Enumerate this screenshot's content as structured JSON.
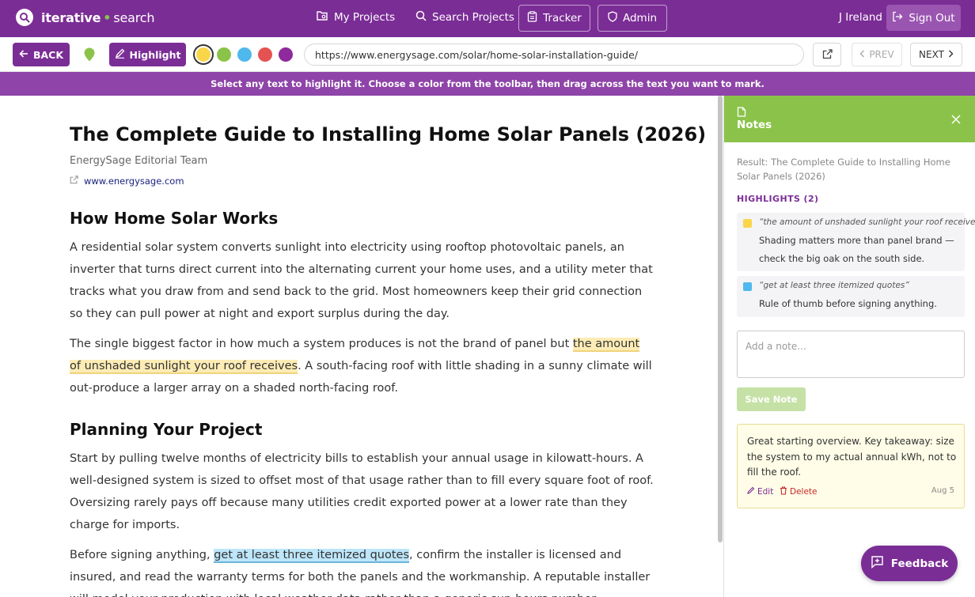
{
  "app": {
    "name_part1": "iterative",
    "name_part2": "search",
    "colors": {
      "primary": "#7b2d96",
      "accent": "#8bc34a",
      "banner": "#8e44a8"
    }
  },
  "nav": {
    "my_projects": "My Projects",
    "search_projects": "Search Projects",
    "tracker": "Tracker",
    "admin": "Admin",
    "user": "J Ireland",
    "sign_out": "Sign Out"
  },
  "toolbar": {
    "back": "BACK",
    "highlight": "Highlight",
    "colors": [
      {
        "name": "yellow",
        "hex": "#f9d54a",
        "selected": true
      },
      {
        "name": "green",
        "hex": "#8bc34a",
        "selected": false
      },
      {
        "name": "blue",
        "hex": "#4fb8ec",
        "selected": false
      },
      {
        "name": "red",
        "hex": "#e55252",
        "selected": false
      },
      {
        "name": "purple",
        "hex": "#8e2a9b",
        "selected": false
      }
    ],
    "url": "https://www.energysage.com/solar/home-solar-installation-guide/",
    "prev": "PREV",
    "next": "NEXT"
  },
  "banner": "Select any text to highlight it. Choose a color from the toolbar, then drag across the text you want to mark.",
  "article": {
    "title": "The Complete Guide to Installing Home Solar Panels (2026)",
    "author": "EnergySage Editorial Team",
    "site": "www.energysage.com",
    "section1": "How Home Solar Works",
    "p1": "A residential solar system converts sunlight into electricity using rooftop photovoltaic panels, an inverter that turns direct current into the alternating current your home uses, and a utility meter that tracks what you draw from and send back to the grid. Most homeowners keep their grid connection so they can pull power at night and export surplus during the day.",
    "p2_before": "The single biggest factor in how much a system produces is not the brand of panel but ",
    "p2_highlight": "the amount of unshaded sunlight your roof receives",
    "p2_after": ". A south-facing roof with little shading in a sunny climate will out-produce a larger array on a shaded north-facing roof.",
    "section2": "Planning Your Project",
    "p3": "Start by pulling twelve months of electricity bills to establish your annual usage in kilowatt-hours. A well-designed system is sized to offset most of that usage rather than to fill every square foot of roof. Oversizing rarely pays off because many utilities credit exported power at a lower rate than they charge for imports.",
    "p4_before": "Before signing anything, ",
    "p4_highlight": "get at least three itemized quotes",
    "p4_after": ", confirm the installer is licensed and insured, and read the warranty terms for both the panels and the workmanship. A reputable installer will model your production with local weather data rather than a generic sun-hours number."
  },
  "notes": {
    "title": "Notes",
    "result": "Result: The Complete Guide to Installing Home Solar Panels (2026)",
    "highlights_heading": "HIGHLIGHTS (2)",
    "highlights": [
      {
        "color": "#f9d54a",
        "quote": "“the amount of unshaded sunlight your roof receives”",
        "note": "Shading matters more than panel brand — check the big oak on the south side."
      },
      {
        "color": "#4fb8ec",
        "quote": "“get at least three itemized quotes”",
        "note": "Rule of thumb before signing anything."
      }
    ],
    "placeholder": "Add a note...",
    "save": "Save Note",
    "saved_note": {
      "text": "Great starting overview. Key takeaway: size the system to my actual annual kWh, not to fill the roof.",
      "edit": "Edit",
      "delete": "Delete",
      "date": "Aug 5"
    }
  },
  "feedback": "Feedback"
}
